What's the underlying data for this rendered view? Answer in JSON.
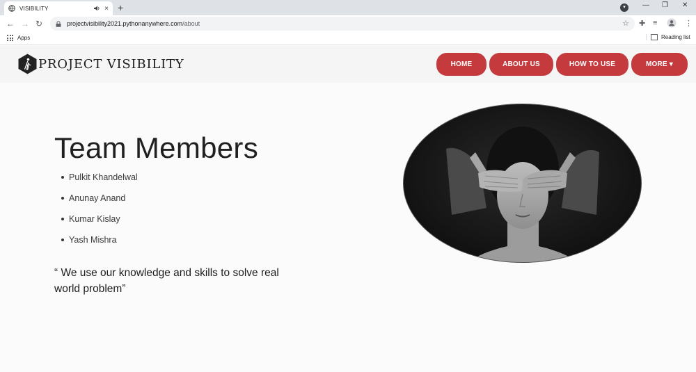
{
  "browser": {
    "tab_title": "VISIBILITY",
    "tab_close": "×",
    "new_tab": "+",
    "url_host": "projectvisibility2021.pythonanywhere.com",
    "url_path": "/about",
    "bookmarks": {
      "apps_label": "Apps",
      "reading_list_label": "Reading list"
    }
  },
  "site": {
    "brand": "PROJECT VISIBILITY",
    "brand_color": "#1b1b1b",
    "accent_color": "#c53b3d",
    "nav": {
      "home": "HOME",
      "about": "ABOUT US",
      "how_to_use": "HOW TO USE",
      "more": "MORE ▾"
    }
  },
  "content": {
    "heading": "Team Members",
    "members": [
      "Pulkit Khandelwal",
      "Anunay Anand",
      "Kumar Kislay",
      "Yash Mishra"
    ],
    "quote": "“ We use our knowledge and skills to solve real world problem”"
  }
}
